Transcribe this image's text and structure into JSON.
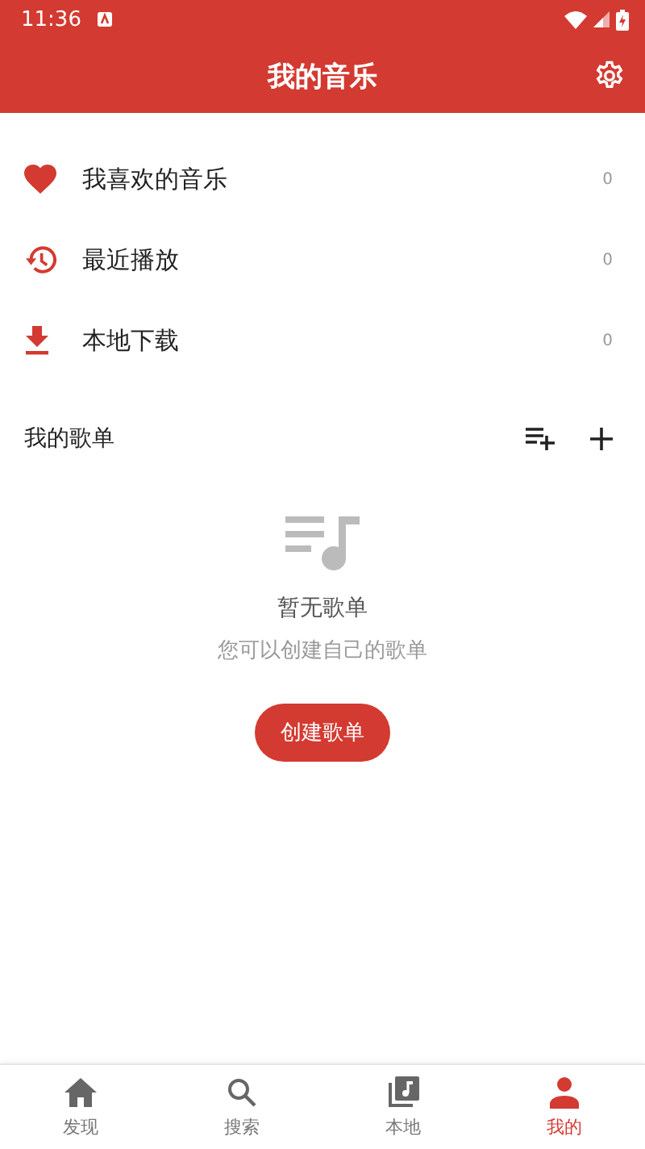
{
  "status_bar": {
    "time": "11:36"
  },
  "header": {
    "title": "我的音乐"
  },
  "menu": [
    {
      "kind": "favorite",
      "label": "我喜欢的音乐",
      "count": "0"
    },
    {
      "kind": "recent",
      "label": "最近播放",
      "count": "0"
    },
    {
      "kind": "download",
      "label": "本地下载",
      "count": "0"
    }
  ],
  "playlists": {
    "title": "我的歌单",
    "empty_title": "暂无歌单",
    "empty_hint": "您可以创建自己的歌单",
    "create_button": "创建歌单"
  },
  "tabs": [
    {
      "kind": "home",
      "label": "发现",
      "selected": false
    },
    {
      "kind": "search",
      "label": "搜索",
      "selected": false
    },
    {
      "kind": "local",
      "label": "本地",
      "selected": false
    },
    {
      "kind": "profile",
      "label": "我的",
      "selected": true
    }
  ]
}
